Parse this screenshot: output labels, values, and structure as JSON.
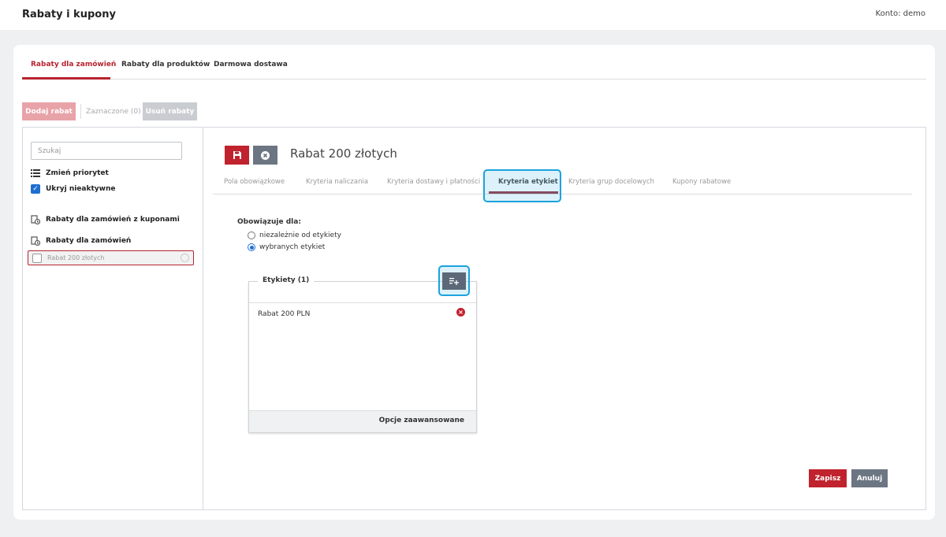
{
  "header": {
    "title": "Rabaty i kupony",
    "account": "Konto: demo"
  },
  "tabs": [
    {
      "label": "Rabaty dla zamówień",
      "active": true
    },
    {
      "label": "Rabaty dla produktów",
      "active": false
    },
    {
      "label": "Darmowa dostawa",
      "active": false
    }
  ],
  "toolbar": {
    "add_label": "Dodaj rabat",
    "selected_label": "Zaznaczone (0)",
    "delete_label": "Usuń rabaty"
  },
  "sidebar": {
    "search_placeholder": "Szukaj",
    "change_priority": "Zmień priorytet",
    "hide_inactive": "Ukryj nieaktywne",
    "hide_inactive_checked": true,
    "group_coupons": "Rabaty dla zamówień z kuponami",
    "group_orders": "Rabaty dla zamówień",
    "items": [
      {
        "label": "Rabat 200 złotych"
      }
    ]
  },
  "detail": {
    "title": "Rabat 200 złotych",
    "subtabs": [
      {
        "label": "Pola obowiązkowe",
        "active": false
      },
      {
        "label": "Kryteria naliczania",
        "active": false
      },
      {
        "label": "Kryteria dostawy i płatności",
        "active": false
      },
      {
        "label": "Kryteria etykiet",
        "active": true
      },
      {
        "label": "Kryteria grup docelowych",
        "active": false
      },
      {
        "label": "Kupony rabatowe",
        "active": false
      }
    ],
    "applies_label": "Obowiązuje dla:",
    "options": [
      {
        "label": "niezależnie od etykiety",
        "selected": false
      },
      {
        "label": "wybranych etykiet",
        "selected": true
      }
    ],
    "labels_box": {
      "legend": "Etykiety (1)",
      "items": [
        {
          "label": "Rabat 200 PLN"
        }
      ],
      "advanced_label": "Opcje zaawansowane"
    }
  },
  "actions": {
    "save_label": "Zapisz",
    "cancel_label": "Anuluj"
  },
  "colors": {
    "accent": "#b8232f",
    "highlight": "#1aa3dc",
    "secondary": "#6c7682"
  }
}
